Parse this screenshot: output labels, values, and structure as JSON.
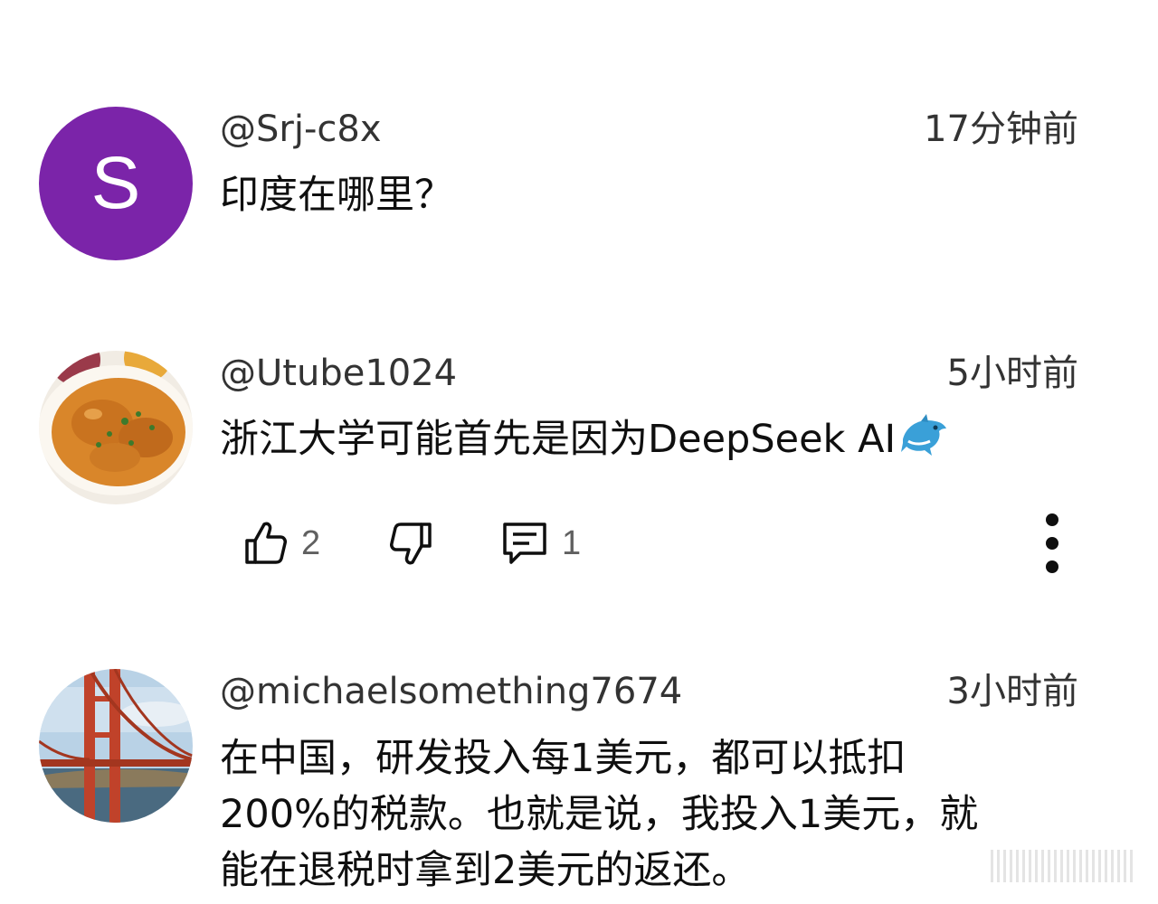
{
  "comments": [
    {
      "avatar_letter": "S",
      "avatar_color": "#7b24a9",
      "handle": "@Srj-c8x",
      "time": "17分钟前",
      "text": "印度在哪里？"
    },
    {
      "avatar_icon": "curry-dish-avatar",
      "handle": "@Utube1024",
      "time": "5小时前",
      "text": "浙江大学可能首先是因为DeepSeek AI",
      "emoji": "dolphin-icon",
      "likes": "2",
      "replies": "1"
    },
    {
      "avatar_icon": "golden-gate-bridge-avatar",
      "handle": "@michaelsomething7674",
      "time": "3小时前",
      "text_lines": [
        "在中国，研发投入每1美元，都可以抵扣",
        "200%的税款。也就是说，我投入1美元，就",
        "能在退税时拿到2美元的返还。"
      ]
    }
  ]
}
